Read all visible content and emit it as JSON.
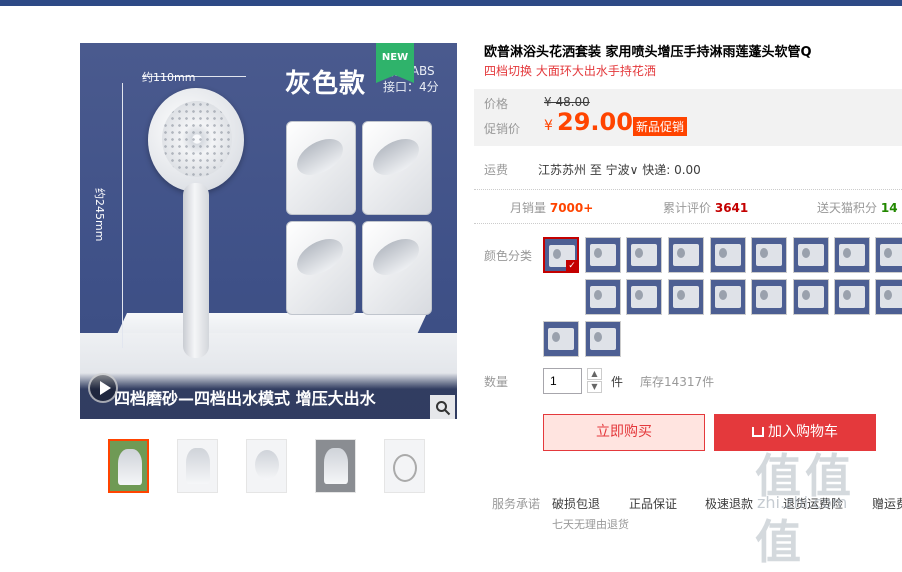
{
  "image": {
    "new_badge": "NEW",
    "color_title": "灰色款",
    "spec_lines": [
      "材质 ABS",
      "接口：4分"
    ],
    "dim_width": "约110mm",
    "dim_height": "约245mm",
    "banner": "四档磨砂—四档出水模式 增压大出水"
  },
  "product": {
    "title": "欧普淋浴头花洒套装 家用喷头增压手持淋雨莲蓬头软管Q",
    "subtitle": "四档切换 大面环大出水手持花洒"
  },
  "price": {
    "orig_label": "价格",
    "orig_value": "¥ 48.00",
    "promo_label": "促销价",
    "yen": "¥",
    "value": "29.00",
    "badge": "新品促销"
  },
  "shipping": {
    "label": "运费",
    "value": "江苏苏州 至 宁波∨ 快递: 0.00"
  },
  "stats": {
    "monthly_label": "月销量",
    "monthly_value": "7000+",
    "reviews_label": "累计评价",
    "reviews_value": "3641",
    "points_label": "送天猫积分",
    "points_value": "14"
  },
  "colors": {
    "label": "颜色分类",
    "selected_index": 0,
    "count": 21
  },
  "quantity": {
    "label": "数量",
    "value": "1",
    "unit": "件",
    "stock": "库存14317件"
  },
  "buttons": {
    "buy": "立即购买",
    "cart": "加入购物车"
  },
  "services": {
    "label": "服务承诺",
    "items": [
      "破损包退",
      "正品保证",
      "极速退款",
      "退货运费险",
      "赠运费险"
    ]
  },
  "watermark": {
    "big": "值值值",
    "small": "zhi.zhi.com"
  },
  "footer_cut": "七天无理由退货"
}
